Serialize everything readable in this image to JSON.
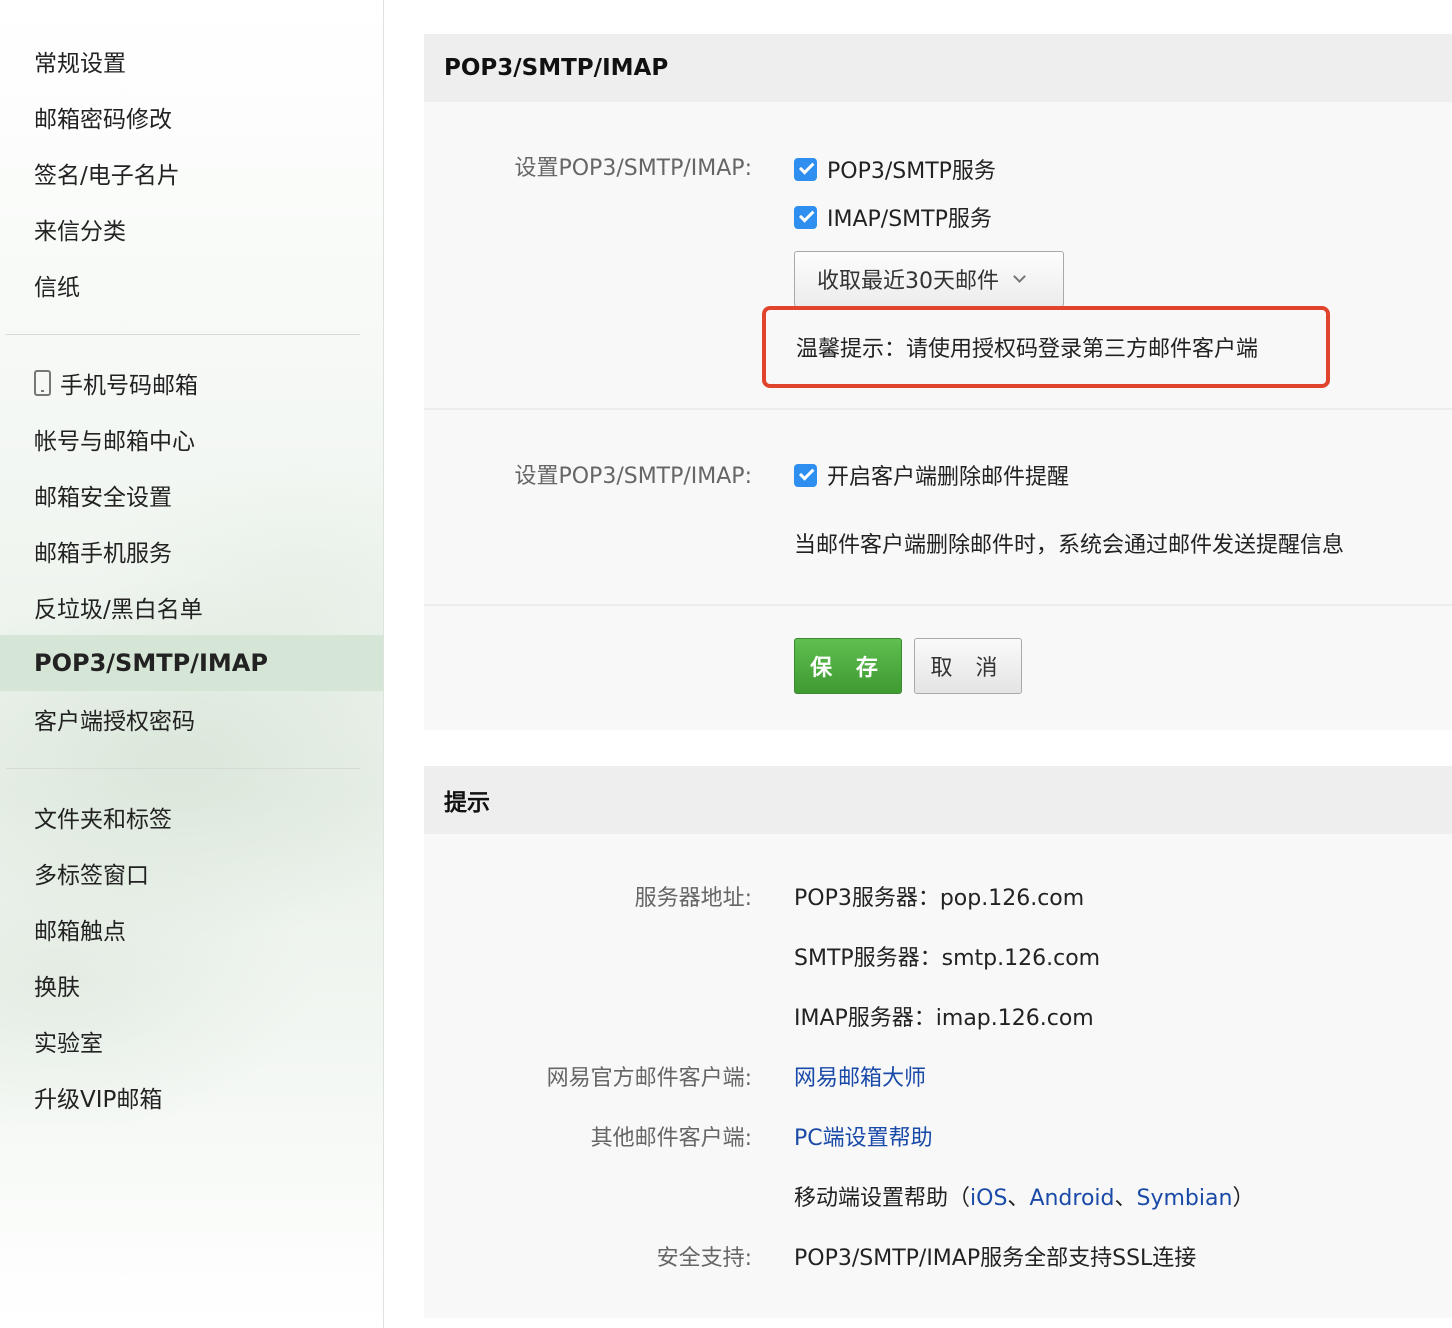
{
  "sidebar": {
    "group1": [
      "常规设置",
      "邮箱密码修改",
      "签名/电子名片",
      "来信分类",
      "信纸"
    ],
    "group2": [
      "手机号码邮箱",
      "帐号与邮箱中心",
      "邮箱安全设置",
      "邮箱手机服务",
      "反垃圾/黑白名单",
      "POP3/SMTP/IMAP",
      "客户端授权密码"
    ],
    "group3": [
      "文件夹和标签",
      "多标签窗口",
      "邮箱触点",
      "换肤",
      "实验室",
      "升级VIP邮箱"
    ],
    "active_item": "POP3/SMTP/IMAP",
    "phone_icon": "phone-icon"
  },
  "settings_panel": {
    "title": "POP3/SMTP/IMAP",
    "section1": {
      "label": "设置POP3/SMTP/IMAP:",
      "pop3_checkbox": {
        "label": "POP3/SMTP服务",
        "checked": true
      },
      "imap_checkbox": {
        "label": "IMAP/SMTP服务",
        "checked": true
      },
      "fetch_select": "收取最近30天邮件",
      "tip": "温馨提示：请使用授权码登录第三方邮件客户端"
    },
    "section2": {
      "label": "设置POP3/SMTP/IMAP:",
      "delete_reminder_checkbox": {
        "label": "开启客户端删除邮件提醒",
        "checked": true
      },
      "description": "当邮件客户端删除邮件时，系统会通过邮件发送提醒信息"
    },
    "buttons": {
      "save": "保 存",
      "cancel": "取 消"
    }
  },
  "hint_panel": {
    "title": "提示",
    "server_label": "服务器地址:",
    "pop3_server": "POP3服务器：pop.126.com",
    "smtp_server": "SMTP服务器：smtp.126.com",
    "imap_server": "IMAP服务器：imap.126.com",
    "official_client_label": "网易官方邮件客户端:",
    "official_client_link": "网易邮箱大师",
    "other_client_label": "其他邮件客户端:",
    "pc_help_link": "PC端设置帮助",
    "mobile_help_prefix": "移动端设置帮助（",
    "mobile_ios": "iOS",
    "mobile_sep1": "、",
    "mobile_android": "Android",
    "mobile_sep2": "、",
    "mobile_symbian": "Symbian",
    "mobile_help_suffix": "）",
    "security_label": "安全支持:",
    "security_value": "POP3/SMTP/IMAP服务全部支持SSL连接"
  },
  "colors": {
    "accent_blue": "#2e8ff0",
    "link_blue": "#1a4aa8",
    "save_green": "#4caf3e",
    "highlight_red": "#e0442c",
    "active_nav_bg": "#d6e6d6"
  }
}
